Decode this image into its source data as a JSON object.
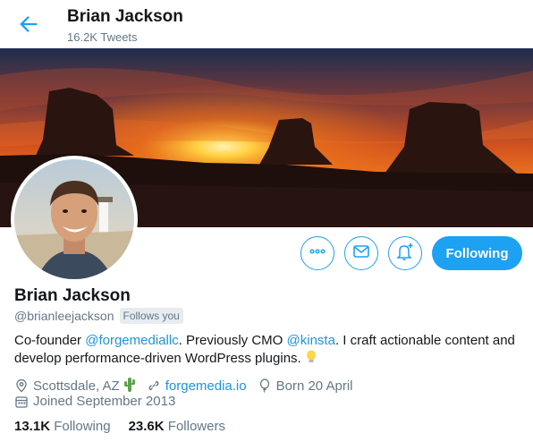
{
  "header": {
    "name": "Brian Jackson",
    "tweet_count": "16.2K Tweets"
  },
  "profile": {
    "name": "Brian Jackson",
    "handle": "@brianleejackson",
    "follows_you": "Follows you",
    "bio": {
      "part1": "Co-founder ",
      "mention1": "@forgemediallc",
      "part2": ". Previously CMO ",
      "mention2": "@kinsta",
      "part3": ". I craft actionable content and develop performance-driven WordPress plugins."
    },
    "location": "Scottsdale, AZ",
    "website": "forgemedia.io",
    "birthday": "Born 20 April",
    "joined": "Joined September 2013"
  },
  "actions": {
    "following_label": "Following"
  },
  "stats": {
    "following_count": "13.1K",
    "following_label": "Following",
    "followers_count": "23.6K",
    "followers_label": "Followers"
  },
  "colors": {
    "accent": "#1da1f2",
    "secondary_text": "#657786",
    "link": "#1b95e0"
  }
}
